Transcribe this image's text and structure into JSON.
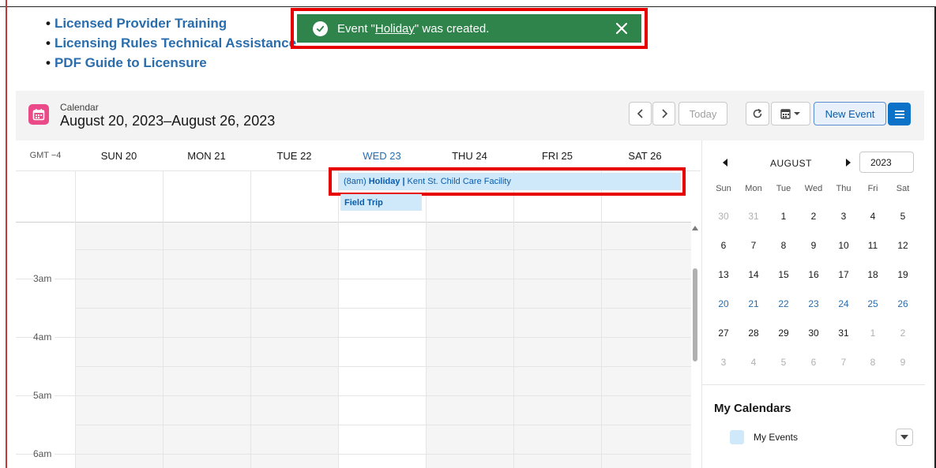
{
  "links": [
    "Licensed Provider Training",
    "Licensing Rules Technical Assistance",
    "PDF Guide to Licensure"
  ],
  "toast": {
    "prefix": "Event \"",
    "event_name": "Holiday",
    "suffix": "\" was created."
  },
  "header": {
    "label": "Calendar",
    "range": "August 20, 2023–August 26, 2023",
    "today_label": "Today",
    "new_event_label": "New Event"
  },
  "grid": {
    "timezone": "GMT −4",
    "days": [
      "SUN 20",
      "MON 21",
      "TUE 22",
      "WED 23",
      "THU 24",
      "FRI 25",
      "SAT 26"
    ],
    "today_index": 3,
    "hours": [
      "3am",
      "4am",
      "5am",
      "6am"
    ],
    "all_day_events": [
      {
        "time": "(8am)",
        "title": "Holiday",
        "separator": "|",
        "location": "Kent St. Child Care Facility"
      },
      {
        "title": "Field Trip"
      }
    ]
  },
  "mini_calendar": {
    "month": "AUGUST",
    "year": "2023",
    "dow": [
      "Sun",
      "Mon",
      "Tue",
      "Wed",
      "Thu",
      "Fri",
      "Sat"
    ],
    "weeks": [
      [
        "30",
        "31",
        "1",
        "2",
        "3",
        "4",
        "5"
      ],
      [
        "6",
        "7",
        "8",
        "9",
        "10",
        "11",
        "12"
      ],
      [
        "13",
        "14",
        "15",
        "16",
        "17",
        "18",
        "19"
      ],
      [
        "20",
        "21",
        "22",
        "23",
        "24",
        "25",
        "26"
      ],
      [
        "27",
        "28",
        "29",
        "30",
        "31",
        "1",
        "2"
      ],
      [
        "3",
        "4",
        "5",
        "6",
        "7",
        "8",
        "9"
      ]
    ],
    "highlight_week": 3
  },
  "my_calendars": {
    "title": "My Calendars",
    "items": [
      "My Events"
    ]
  },
  "colors": {
    "accent": "#0b72c7",
    "toast_bg": "#2e844a",
    "event_bg": "#cfe9fb",
    "highlight_box": "#e60000",
    "calendar_icon": "#eb4a88"
  }
}
